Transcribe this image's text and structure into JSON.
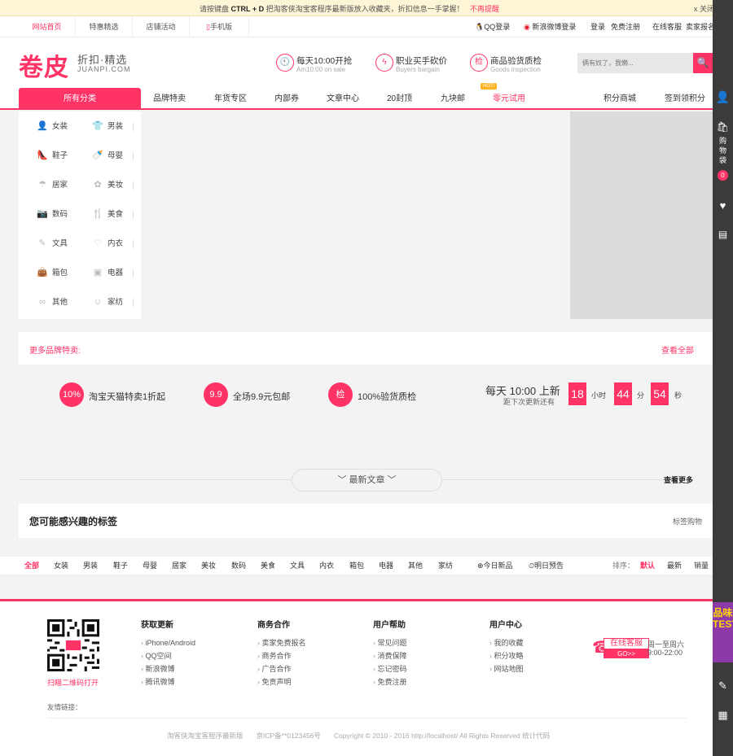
{
  "notice": {
    "msg_pre": "请按键盘",
    "msg_key": "CTRL + D",
    "msg_post": "把淘客侠淘宝客程序最新版放入收藏夹，折扣信息一手掌握！",
    "no_remind": "不再提醒",
    "close": "x 关闭"
  },
  "topbar": {
    "tabs": [
      "网站首页",
      "特惠精选",
      "店铺活动",
      "手机版"
    ],
    "links": [
      "QQ登录",
      "新浪微博登录",
      "登录",
      "免费注册",
      "在线客服",
      "卖家报名"
    ]
  },
  "header": {
    "logo": "卷皮",
    "slogan": "折扣·精选",
    "domain": "JUANPI.COM",
    "features": [
      {
        "icon": "🕙",
        "title": "每天10:00开抢",
        "sub": "Am10:00 on sale"
      },
      {
        "icon": "ϟ",
        "title": "职业买手砍价",
        "sub": "Buyers bargain"
      },
      {
        "icon": "检",
        "title": "商品验货质检",
        "sub": "Goods inspection"
      }
    ],
    "search_placeholder": "俩有奴了，我懒...",
    "search_icon": "🔍"
  },
  "nav": {
    "all": "所有分类",
    "items": [
      "品牌特卖",
      "年货专区",
      "内部券",
      "文章中心",
      "20封顶",
      "九块邮",
      "零元试用"
    ],
    "hot_badge": "HOT!",
    "right": [
      "积分商城",
      "签到领积分"
    ]
  },
  "categories": [
    {
      "icon": "👤",
      "label": "女装"
    },
    {
      "icon": "👕",
      "label": "男装"
    },
    {
      "icon": "👠",
      "label": "鞋子"
    },
    {
      "icon": "🍼",
      "label": "母婴"
    },
    {
      "icon": "☂",
      "label": "居家"
    },
    {
      "icon": "✿",
      "label": "美妆"
    },
    {
      "icon": "📷",
      "label": "数码"
    },
    {
      "icon": "🍴",
      "label": "美食"
    },
    {
      "icon": "✎",
      "label": "文具"
    },
    {
      "icon": "♡",
      "label": "内衣"
    },
    {
      "icon": "👜",
      "label": "箱包"
    },
    {
      "icon": "▣",
      "label": "电器"
    },
    {
      "icon": "∞",
      "label": "其他"
    },
    {
      "icon": "☺",
      "label": "家纺"
    }
  ],
  "brand": {
    "more": "更多品牌特卖:",
    "all": "查看全部"
  },
  "promo": [
    {
      "icon": "10%",
      "text": "淘宝天猫特卖1折起"
    },
    {
      "icon": "9.9",
      "text": "全场9.9元包邮"
    },
    {
      "icon": "检",
      "text": "100%验货质检"
    }
  ],
  "countdown": {
    "title": "每天 10:00 上新",
    "sub": "距下次更新还有",
    "hours": "18",
    "hours_u": "小时",
    "mins": "44",
    "mins_u": "分",
    "secs": "54",
    "secs_u": "秒"
  },
  "articles": {
    "label": "﹀  最新文章  ﹀",
    "more": "查看更多"
  },
  "tags": {
    "title": "您可能感兴趣的标签",
    "right": "标签购物"
  },
  "filter": {
    "items": [
      "全部",
      "女装",
      "男装",
      "鞋子",
      "母婴",
      "居家",
      "美妆",
      "数码",
      "美食",
      "文具",
      "内衣",
      "箱包",
      "电器",
      "其他",
      "家纺"
    ],
    "today": "⊕今日新品",
    "tomorrow": "⏲明日预告",
    "sort": "排序：",
    "sorts": [
      "默认",
      "最新",
      "销量"
    ]
  },
  "footer": {
    "qr_caption": "扫瞄二维码打开",
    "cols": [
      {
        "title": "获取更新",
        "items": [
          "iPhone/Android",
          "QQ空间",
          "新浪微博",
          "腾讯微博"
        ]
      },
      {
        "title": "商务合作",
        "items": [
          "卖家免费报名",
          "商务合作",
          "广告合作",
          "免责声明"
        ]
      },
      {
        "title": "用户帮助",
        "items": [
          "常见问题",
          "消费保障",
          "忘记密码",
          "免费注册"
        ]
      },
      {
        "title": "用户中心",
        "items": [
          "我的收藏",
          "积分攻略",
          "网站地图"
        ]
      }
    ],
    "service": {
      "btn": "在线客服",
      "go": "GO>>",
      "days": "周一至周六",
      "hours": "9:00-22:00"
    },
    "friend": "友情链接：",
    "copy": [
      "淘客侠淘宝客程序最新版",
      "京ICP备**0123456号",
      "Copyright © 2010 - 2016 http://localhost/ All Rights Reserved 统计代码"
    ]
  },
  "dock": {
    "cart": "购物袋",
    "cart_count": "0",
    "pinwei": "品味TEST"
  },
  "colors": {
    "accent": "#ff3366",
    "dock": "#3d3a3b"
  }
}
